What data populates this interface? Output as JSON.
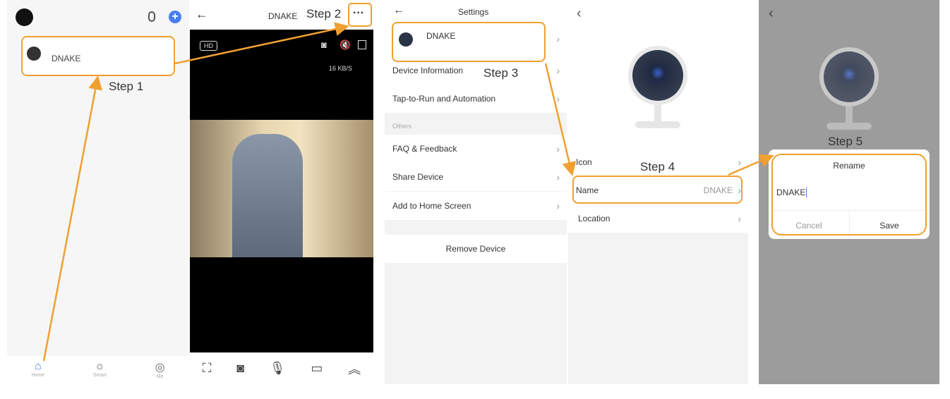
{
  "steps": [
    "Step 1",
    "Step 2",
    "Step 3",
    "Step 4",
    "Step 5"
  ],
  "home": {
    "device_name": "DNAKE",
    "nav": [
      {
        "label": "Home"
      },
      {
        "label": "Smart"
      },
      {
        "label": "Me"
      }
    ]
  },
  "live": {
    "title": "DNAKE",
    "quality": "HD",
    "speed": "16 KB/S"
  },
  "settings": {
    "title": "Settings",
    "device_name": "DNAKE",
    "rows": [
      "Device Information",
      "Tap-to-Run and Automation"
    ],
    "section": "Others",
    "rows2": [
      "FAQ & Feedback",
      "Share Device",
      "Add to Home Screen"
    ],
    "remove": "Remove Device"
  },
  "device": {
    "icon_label": "Icon",
    "name_label": "Name",
    "name_value": "DNAKE",
    "location_label": "Location"
  },
  "rename": {
    "title": "Rename",
    "value": "DNAKE",
    "cancel": "Cancel",
    "save": "Save"
  },
  "colors": {
    "accent": "#f0a030",
    "blue": "#4a7ef0"
  }
}
